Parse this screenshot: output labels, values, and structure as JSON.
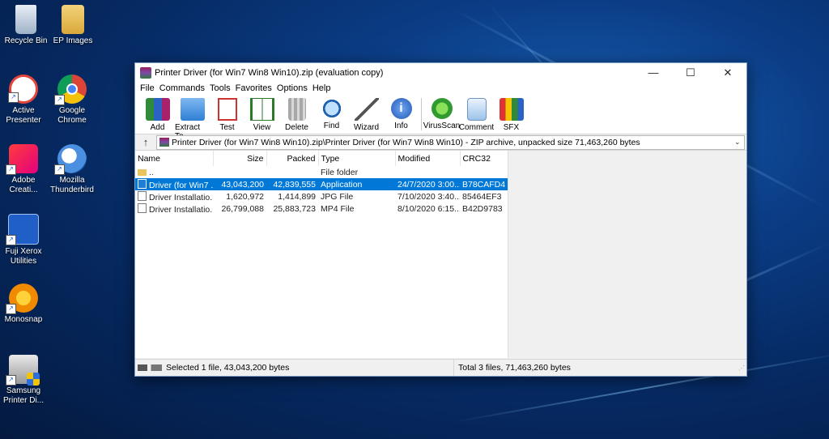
{
  "desktop": {
    "icons": [
      {
        "label": "Recycle Bin",
        "icon": "recycle-bin-icon"
      },
      {
        "label": "EP Images",
        "icon": "folder-icon"
      },
      {
        "label": "Active Presenter",
        "icon": "active-presenter-icon"
      },
      {
        "label": "Google Chrome",
        "icon": "chrome-icon"
      },
      {
        "label": "Adobe Creati...",
        "icon": "adobe-cc-icon"
      },
      {
        "label": "Mozilla Thunderbird",
        "icon": "thunderbird-icon"
      },
      {
        "label": "Fuji Xerox Utilities",
        "icon": "fuji-xerox-icon"
      },
      {
        "label": "Monosnap",
        "icon": "monosnap-icon"
      },
      {
        "label": "Samsung Printer Di...",
        "icon": "samsung-printer-icon"
      }
    ]
  },
  "window": {
    "title": "Printer Driver (for Win7 Win8 Win10).zip (evaluation copy)",
    "controls": {
      "minimize": "—",
      "maximize": "☐",
      "close": "✕"
    },
    "menu": [
      "File",
      "Commands",
      "Tools",
      "Favorites",
      "Options",
      "Help"
    ],
    "toolbar": [
      {
        "label": "Add",
        "icon": "add-archive-icon"
      },
      {
        "label": "Extract To",
        "icon": "extract-folder-icon"
      },
      {
        "label": "Test",
        "icon": "test-checklist-icon"
      },
      {
        "label": "View",
        "icon": "view-book-icon"
      },
      {
        "label": "Delete",
        "icon": "trash-icon"
      },
      {
        "label": "Find",
        "icon": "magnifier-icon"
      },
      {
        "label": "Wizard",
        "icon": "wizard-wand-icon"
      },
      {
        "label": "Info",
        "icon": "info-icon"
      },
      {
        "label": "VirusScan",
        "icon": "virus-scan-icon"
      },
      {
        "label": "Comment",
        "icon": "comment-icon"
      },
      {
        "label": "SFX",
        "icon": "sfx-archive-icon"
      }
    ],
    "path": {
      "up": "↑",
      "text": "Printer Driver (for Win7 Win8 Win10).zip\\Printer Driver (for Win7 Win8 Win10) - ZIP archive, unpacked size 71,463,260 bytes"
    },
    "columns": {
      "name": "Name",
      "size": "Size",
      "packed": "Packed",
      "type": "Type",
      "modified": "Modified",
      "crc": "CRC32"
    },
    "rows": [
      {
        "name": "..",
        "size": "",
        "packed": "",
        "type": "File folder",
        "modified": "",
        "crc": "",
        "icon": "folder"
      },
      {
        "name": "Driver (for Win7 ...",
        "size": "43,043,200",
        "packed": "42,839,555",
        "type": "Application",
        "modified": "24/7/2020 3:00...",
        "crc": "B78CAFD4",
        "icon": "app",
        "selected": true
      },
      {
        "name": "Driver Installatio...",
        "size": "1,620,972",
        "packed": "1,414,899",
        "type": "JPG File",
        "modified": "7/10/2020 3:40...",
        "crc": "85464EF3",
        "icon": "file"
      },
      {
        "name": "Driver Installatio...",
        "size": "26,799,088",
        "packed": "25,883,723",
        "type": "MP4 File",
        "modified": "8/10/2020 6:15...",
        "crc": "B42D9783",
        "icon": "file"
      }
    ],
    "status": {
      "left": "Selected 1 file, 43,043,200 bytes",
      "right": "Total 3 files, 71,463,260 bytes"
    }
  }
}
